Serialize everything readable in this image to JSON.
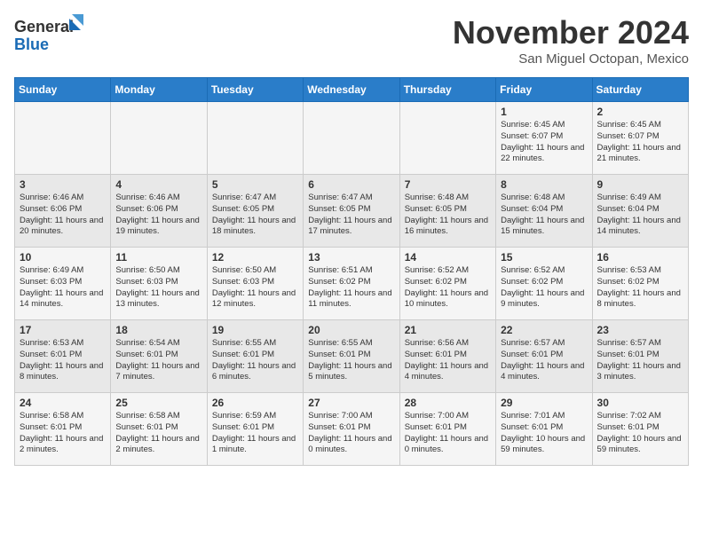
{
  "logo": {
    "line1": "General",
    "line2": "Blue"
  },
  "title": "November 2024",
  "subtitle": "San Miguel Octopan, Mexico",
  "days_header": [
    "Sunday",
    "Monday",
    "Tuesday",
    "Wednesday",
    "Thursday",
    "Friday",
    "Saturday"
  ],
  "weeks": [
    [
      {
        "day": "",
        "info": ""
      },
      {
        "day": "",
        "info": ""
      },
      {
        "day": "",
        "info": ""
      },
      {
        "day": "",
        "info": ""
      },
      {
        "day": "",
        "info": ""
      },
      {
        "day": "1",
        "info": "Sunrise: 6:45 AM\nSunset: 6:07 PM\nDaylight: 11 hours and 22 minutes."
      },
      {
        "day": "2",
        "info": "Sunrise: 6:45 AM\nSunset: 6:07 PM\nDaylight: 11 hours and 21 minutes."
      }
    ],
    [
      {
        "day": "3",
        "info": "Sunrise: 6:46 AM\nSunset: 6:06 PM\nDaylight: 11 hours and 20 minutes."
      },
      {
        "day": "4",
        "info": "Sunrise: 6:46 AM\nSunset: 6:06 PM\nDaylight: 11 hours and 19 minutes."
      },
      {
        "day": "5",
        "info": "Sunrise: 6:47 AM\nSunset: 6:05 PM\nDaylight: 11 hours and 18 minutes."
      },
      {
        "day": "6",
        "info": "Sunrise: 6:47 AM\nSunset: 6:05 PM\nDaylight: 11 hours and 17 minutes."
      },
      {
        "day": "7",
        "info": "Sunrise: 6:48 AM\nSunset: 6:05 PM\nDaylight: 11 hours and 16 minutes."
      },
      {
        "day": "8",
        "info": "Sunrise: 6:48 AM\nSunset: 6:04 PM\nDaylight: 11 hours and 15 minutes."
      },
      {
        "day": "9",
        "info": "Sunrise: 6:49 AM\nSunset: 6:04 PM\nDaylight: 11 hours and 14 minutes."
      }
    ],
    [
      {
        "day": "10",
        "info": "Sunrise: 6:49 AM\nSunset: 6:03 PM\nDaylight: 11 hours and 14 minutes."
      },
      {
        "day": "11",
        "info": "Sunrise: 6:50 AM\nSunset: 6:03 PM\nDaylight: 11 hours and 13 minutes."
      },
      {
        "day": "12",
        "info": "Sunrise: 6:50 AM\nSunset: 6:03 PM\nDaylight: 11 hours and 12 minutes."
      },
      {
        "day": "13",
        "info": "Sunrise: 6:51 AM\nSunset: 6:02 PM\nDaylight: 11 hours and 11 minutes."
      },
      {
        "day": "14",
        "info": "Sunrise: 6:52 AM\nSunset: 6:02 PM\nDaylight: 11 hours and 10 minutes."
      },
      {
        "day": "15",
        "info": "Sunrise: 6:52 AM\nSunset: 6:02 PM\nDaylight: 11 hours and 9 minutes."
      },
      {
        "day": "16",
        "info": "Sunrise: 6:53 AM\nSunset: 6:02 PM\nDaylight: 11 hours and 8 minutes."
      }
    ],
    [
      {
        "day": "17",
        "info": "Sunrise: 6:53 AM\nSunset: 6:01 PM\nDaylight: 11 hours and 8 minutes."
      },
      {
        "day": "18",
        "info": "Sunrise: 6:54 AM\nSunset: 6:01 PM\nDaylight: 11 hours and 7 minutes."
      },
      {
        "day": "19",
        "info": "Sunrise: 6:55 AM\nSunset: 6:01 PM\nDaylight: 11 hours and 6 minutes."
      },
      {
        "day": "20",
        "info": "Sunrise: 6:55 AM\nSunset: 6:01 PM\nDaylight: 11 hours and 5 minutes."
      },
      {
        "day": "21",
        "info": "Sunrise: 6:56 AM\nSunset: 6:01 PM\nDaylight: 11 hours and 4 minutes."
      },
      {
        "day": "22",
        "info": "Sunrise: 6:57 AM\nSunset: 6:01 PM\nDaylight: 11 hours and 4 minutes."
      },
      {
        "day": "23",
        "info": "Sunrise: 6:57 AM\nSunset: 6:01 PM\nDaylight: 11 hours and 3 minutes."
      }
    ],
    [
      {
        "day": "24",
        "info": "Sunrise: 6:58 AM\nSunset: 6:01 PM\nDaylight: 11 hours and 2 minutes."
      },
      {
        "day": "25",
        "info": "Sunrise: 6:58 AM\nSunset: 6:01 PM\nDaylight: 11 hours and 2 minutes."
      },
      {
        "day": "26",
        "info": "Sunrise: 6:59 AM\nSunset: 6:01 PM\nDaylight: 11 hours and 1 minute."
      },
      {
        "day": "27",
        "info": "Sunrise: 7:00 AM\nSunset: 6:01 PM\nDaylight: 11 hours and 0 minutes."
      },
      {
        "day": "28",
        "info": "Sunrise: 7:00 AM\nSunset: 6:01 PM\nDaylight: 11 hours and 0 minutes."
      },
      {
        "day": "29",
        "info": "Sunrise: 7:01 AM\nSunset: 6:01 PM\nDaylight: 10 hours and 59 minutes."
      },
      {
        "day": "30",
        "info": "Sunrise: 7:02 AM\nSunset: 6:01 PM\nDaylight: 10 hours and 59 minutes."
      }
    ]
  ]
}
